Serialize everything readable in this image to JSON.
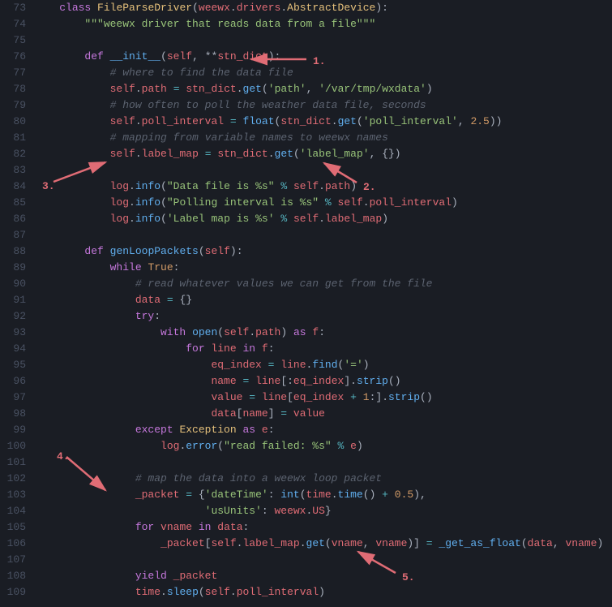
{
  "lines": [
    {
      "num": "73",
      "html": "    <span class='kw'>class</span> <span class='cls'>FileParseDriver</span>(<span class='self'>weewx</span>.<span class='prop'>drivers</span>.<span class='cls'>AbstractDevice</span>):"
    },
    {
      "num": "74",
      "html": "        <span class='str'>\"\"\"weewx driver that reads data from a file\"\"\"</span>"
    },
    {
      "num": "75",
      "html": ""
    },
    {
      "num": "76",
      "html": "        <span class='kw'>def</span> <span class='fn'>__init__</span>(<span class='self'>self</span>, **<span class='self'>stn_dict</span>):"
    },
    {
      "num": "77",
      "html": "            <span class='cm'># where to find the data file</span>"
    },
    {
      "num": "78",
      "html": "            <span class='self'>self</span>.<span class='prop'>path</span> <span class='op'>=</span> <span class='self'>stn_dict</span>.<span class='fn'>get</span>(<span class='str'>'path'</span>, <span class='str'>'/var/tmp/wxdata'</span>)"
    },
    {
      "num": "79",
      "html": "            <span class='cm'># how often to poll the weather data file, seconds</span>"
    },
    {
      "num": "80",
      "html": "            <span class='self'>self</span>.<span class='prop'>poll_interval</span> <span class='op'>=</span> <span class='fn'>float</span>(<span class='self'>stn_dict</span>.<span class='fn'>get</span>(<span class='str'>'poll_interval'</span>, <span class='num'>2.5</span>))"
    },
    {
      "num": "81",
      "html": "            <span class='cm'># mapping from variable names to weewx names</span>"
    },
    {
      "num": "82",
      "html": "            <span class='self'>self</span>.<span class='prop'>label_map</span> <span class='op'>=</span> <span class='self'>stn_dict</span>.<span class='fn'>get</span>(<span class='str'>'label_map'</span>, {})"
    },
    {
      "num": "83",
      "html": ""
    },
    {
      "num": "84",
      "html": "            <span class='self'>log</span>.<span class='fn'>info</span>(<span class='str'>\"Data file is %s\"</span> <span class='op'>%</span> <span class='self'>self</span>.<span class='prop'>path</span>)"
    },
    {
      "num": "85",
      "html": "            <span class='self'>log</span>.<span class='fn'>info</span>(<span class='str'>\"Polling interval is %s\"</span> <span class='op'>%</span> <span class='self'>self</span>.<span class='prop'>poll_interval</span>)"
    },
    {
      "num": "86",
      "html": "            <span class='self'>log</span>.<span class='fn'>info</span>(<span class='str'>'Label map is %s'</span> <span class='op'>%</span> <span class='self'>self</span>.<span class='prop'>label_map</span>)"
    },
    {
      "num": "87",
      "html": ""
    },
    {
      "num": "88",
      "html": "        <span class='kw'>def</span> <span class='fn'>genLoopPackets</span>(<span class='self'>self</span>):"
    },
    {
      "num": "89",
      "html": "            <span class='kw'>while</span> <span class='bool'>True</span>:"
    },
    {
      "num": "90",
      "html": "                <span class='cm'># read whatever values we can get from the file</span>"
    },
    {
      "num": "91",
      "html": "                <span class='self'>data</span> <span class='op'>=</span> {}"
    },
    {
      "num": "92",
      "html": "                <span class='kw'>try</span>:"
    },
    {
      "num": "93",
      "html": "                    <span class='kw'>with</span> <span class='fn'>open</span>(<span class='self'>self</span>.<span class='prop'>path</span>) <span class='kw'>as</span> <span class='self'>f</span>:"
    },
    {
      "num": "94",
      "html": "                        <span class='kw'>for</span> <span class='self'>line</span> <span class='kw'>in</span> <span class='self'>f</span>:"
    },
    {
      "num": "95",
      "html": "                            <span class='self'>eq_index</span> <span class='op'>=</span> <span class='self'>line</span>.<span class='fn'>find</span>(<span class='str'>'='</span>)"
    },
    {
      "num": "96",
      "html": "                            <span class='self'>name</span> <span class='op'>=</span> <span class='self'>line</span>[:<span class='self'>eq_index</span>].<span class='fn'>strip</span>()"
    },
    {
      "num": "97",
      "html": "                            <span class='self'>value</span> <span class='op'>=</span> <span class='self'>line</span>[<span class='self'>eq_index</span> <span class='op'>+</span> <span class='num'>1</span>:].<span class='fn'>strip</span>()"
    },
    {
      "num": "98",
      "html": "                            <span class='self'>data</span>[<span class='self'>name</span>] <span class='op'>=</span> <span class='self'>value</span>"
    },
    {
      "num": "99",
      "html": "                <span class='kw'>except</span> <span class='cls'>Exception</span> <span class='kw'>as</span> <span class='self'>e</span>:"
    },
    {
      "num": "100",
      "html": "                    <span class='self'>log</span>.<span class='fn'>error</span>(<span class='str'>\"read failed: %s\"</span> <span class='op'>%</span> <span class='self'>e</span>)"
    },
    {
      "num": "101",
      "html": ""
    },
    {
      "num": "102",
      "html": "                <span class='cm'># map the data into a weewx loop packet</span>"
    },
    {
      "num": "103",
      "html": "                <span class='self'>_packet</span> <span class='op'>=</span> {<span class='str'>'dateTime'</span>: <span class='fn'>int</span>(<span class='self'>time</span>.<span class='fn'>time</span>() <span class='op'>+</span> <span class='num'>0.5</span>),"
    },
    {
      "num": "104",
      "html": "                           <span class='str'>'usUnits'</span>: <span class='self'>weewx</span>.<span class='prop'>US</span>}"
    },
    {
      "num": "105",
      "html": "                <span class='kw'>for</span> <span class='self'>vname</span> <span class='kw'>in</span> <span class='self'>data</span>:"
    },
    {
      "num": "106",
      "html": "                    <span class='self'>_packet</span>[<span class='self'>self</span>.<span class='prop'>label_map</span>.<span class='fn'>get</span>(<span class='self'>vname</span>, <span class='self'>vname</span>)] <span class='op'>=</span> <span class='fn'>_get_as_float</span>(<span class='self'>data</span>, <span class='self'>vname</span>)"
    },
    {
      "num": "107",
      "html": ""
    },
    {
      "num": "108",
      "html": "                <span class='kw'>yield</span> <span class='self'>_packet</span>"
    },
    {
      "num": "109",
      "html": "                <span class='self'>time</span>.<span class='fn'>sleep</span>(<span class='self'>self</span>.<span class='prop'>poll_interval</span>)"
    }
  ],
  "annotations": {
    "label1": "1.",
    "label2": "2.",
    "label3": "3.",
    "label4": "4.",
    "label5": "5."
  }
}
